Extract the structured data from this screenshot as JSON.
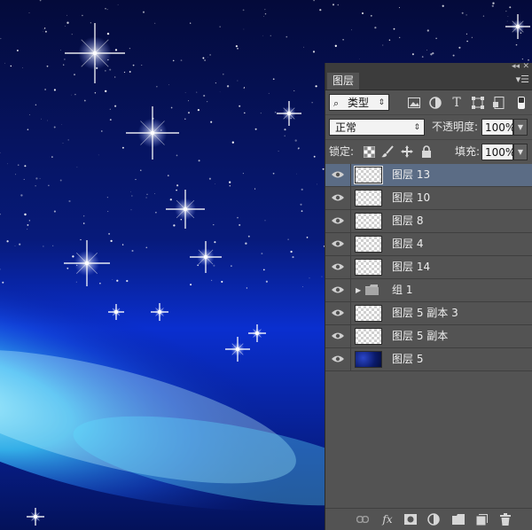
{
  "panel": {
    "tab_label": "图层",
    "filter_label": "类型",
    "blend_mode": "正常",
    "opacity_label": "不透明度:",
    "opacity_value": "100%",
    "lock_label": "锁定:",
    "fill_label": "填充:",
    "fill_value": "100%",
    "layers": [
      {
        "name": "图层 13",
        "selected": true,
        "thumb": "transparent"
      },
      {
        "name": "图层 10",
        "selected": false,
        "thumb": "transparent"
      },
      {
        "name": "图层 8",
        "selected": false,
        "thumb": "transparent"
      },
      {
        "name": "图层 4",
        "selected": false,
        "thumb": "transparent"
      },
      {
        "name": "图层 14",
        "selected": false,
        "thumb": "transparent"
      },
      {
        "name": "组 1",
        "selected": false,
        "thumb": "folder"
      },
      {
        "name": "图层 5 副本 3",
        "selected": false,
        "thumb": "transparent"
      },
      {
        "name": "图层 5 副本",
        "selected": false,
        "thumb": "transparent"
      },
      {
        "name": "图层 5",
        "selected": false,
        "thumb": "dark"
      }
    ],
    "filter_icons": [
      "image-filter-icon",
      "adjustment-filter-icon",
      "type-filter-icon",
      "shape-filter-icon",
      "smart-object-filter-icon"
    ],
    "lock_icons": [
      "lock-transparent-icon",
      "lock-paint-icon",
      "lock-move-icon",
      "lock-all-icon"
    ],
    "bottom_icons": [
      "link-layers-icon",
      "fx-icon",
      "mask-icon",
      "adjustment-layer-icon",
      "new-group-icon",
      "new-layer-icon",
      "delete-layer-icon"
    ],
    "fx_text": "fx",
    "selected_color": "#5b6c85",
    "panel_color": "#535353"
  },
  "canvas": {
    "colors": {
      "deep_space": "#03082e",
      "nebula_blue": "#1a3ad6",
      "glow_cyan": "#7fe8ff"
    }
  }
}
